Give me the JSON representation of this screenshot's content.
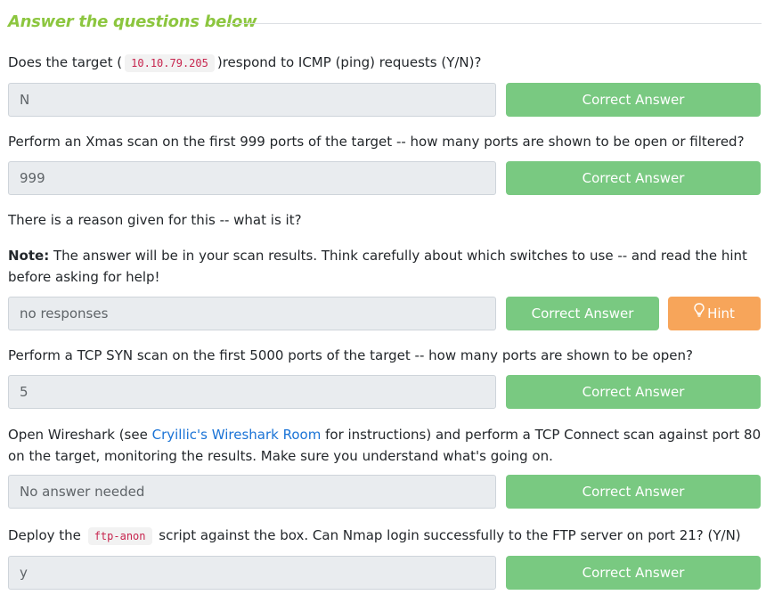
{
  "section_title": "Answer the questions below",
  "questions": [
    {
      "pre": "Does the target (",
      "code": "10.10.79.205",
      "post": ")respond to ICMP (ping) requests (Y/N)?",
      "answer": "N",
      "button": "Correct Answer"
    },
    {
      "text": "Perform an Xmas scan on the first 999 ports of the target -- how many ports are shown to be open or filtered?",
      "answer": "999",
      "button": "Correct Answer"
    },
    {
      "text": "There is a reason given for this -- what is it?",
      "note_label": "Note:",
      "note_text": " The answer will be in your scan results. Think carefully about which switches to use -- and read the hint before asking for help!",
      "answer": "no responses",
      "button": "Correct Answer",
      "hint": "Hint"
    },
    {
      "text": "Perform a TCP SYN scan on the first 5000 ports of the target -- how many ports are shown to be open?",
      "answer": "5",
      "button": "Correct Answer"
    },
    {
      "pre": "Open Wireshark (see ",
      "link": "Cryillic's Wireshark Room",
      "post": " for instructions) and perform a TCP Connect scan against port 80 on the target, monitoring the results. Make sure you understand what's going on.",
      "answer": "No answer needed",
      "button": "Correct Answer"
    },
    {
      "pre": "Deploy the",
      "code": "ftp-anon",
      "post": "script against the box. Can Nmap login successfully to the FTP server on port 21? (Y/N)",
      "answer": "y",
      "button": "Correct Answer"
    }
  ],
  "colors": {
    "heading": "#8cc63f",
    "correct_button": "#79c981",
    "hint_button": "#f7a55a",
    "link": "#1a73d6",
    "code_text": "#c7254e"
  },
  "icons": {
    "hint": "lightbulb-icon"
  }
}
